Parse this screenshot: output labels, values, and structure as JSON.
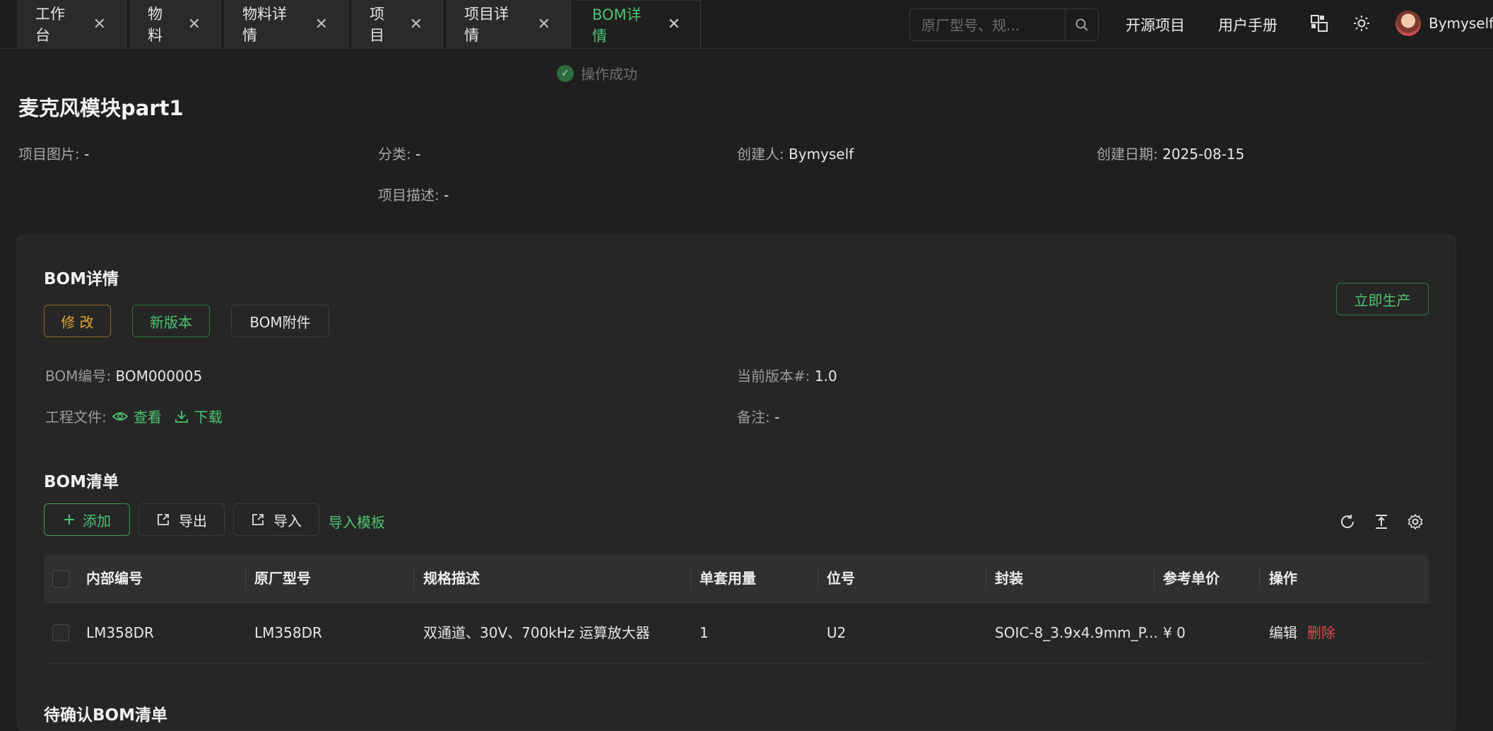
{
  "tabs": [
    {
      "label": "工作台"
    },
    {
      "label": "物料"
    },
    {
      "label": "物料详情"
    },
    {
      "label": "项目"
    },
    {
      "label": "项目详情"
    },
    {
      "label": "BOM详情"
    }
  ],
  "header": {
    "search_placeholder": "原厂型号、规...",
    "open_source": "开源项目",
    "manual": "用户手册",
    "username": "Bymyself"
  },
  "toast": "操作成功",
  "project": {
    "title": "麦克风模块part1",
    "image_label": "项目图片:",
    "image_value": "-",
    "category_label": "分类:",
    "category_value": "-",
    "creator_label": "创建人:",
    "creator_value": "Bymyself",
    "date_label": "创建日期:",
    "date_value": "2025-08-15",
    "desc_label": "项目描述:",
    "desc_value": "-"
  },
  "bom": {
    "heading": "BOM详情",
    "edit": "修 改",
    "new_version": "新版本",
    "attachment": "BOM附件",
    "produce": "立即生产",
    "code_label": "BOM编号:",
    "code_value": "BOM000005",
    "version_label": "当前版本#:",
    "version_value": "1.0",
    "files_label": "工程文件:",
    "view": "查看",
    "download": "下载",
    "remark_label": "备注:",
    "remark_value": "-"
  },
  "list": {
    "heading": "BOM清单",
    "add": "添加",
    "export": "导出",
    "import": "导入",
    "template": "导入模板",
    "columns": [
      "内部编号",
      "原厂型号",
      "规格描述",
      "单套用量",
      "位号",
      "封装",
      "参考单价",
      "操作"
    ],
    "rows": [
      {
        "internal": "LM358DR",
        "mpn": "LM358DR",
        "spec": "双通道、30V、700kHz 运算放大器",
        "qty": "1",
        "ref": "U2",
        "package": "SOIC-8_3.9x4.9mm_P...",
        "price": "¥ 0",
        "edit": "编辑",
        "delete": "删除"
      }
    ]
  },
  "pending_heading": "待确认BOM清单",
  "colors": {
    "accent": "#4cc56f",
    "warning": "#e3a62f",
    "danger": "#e04a4a"
  }
}
